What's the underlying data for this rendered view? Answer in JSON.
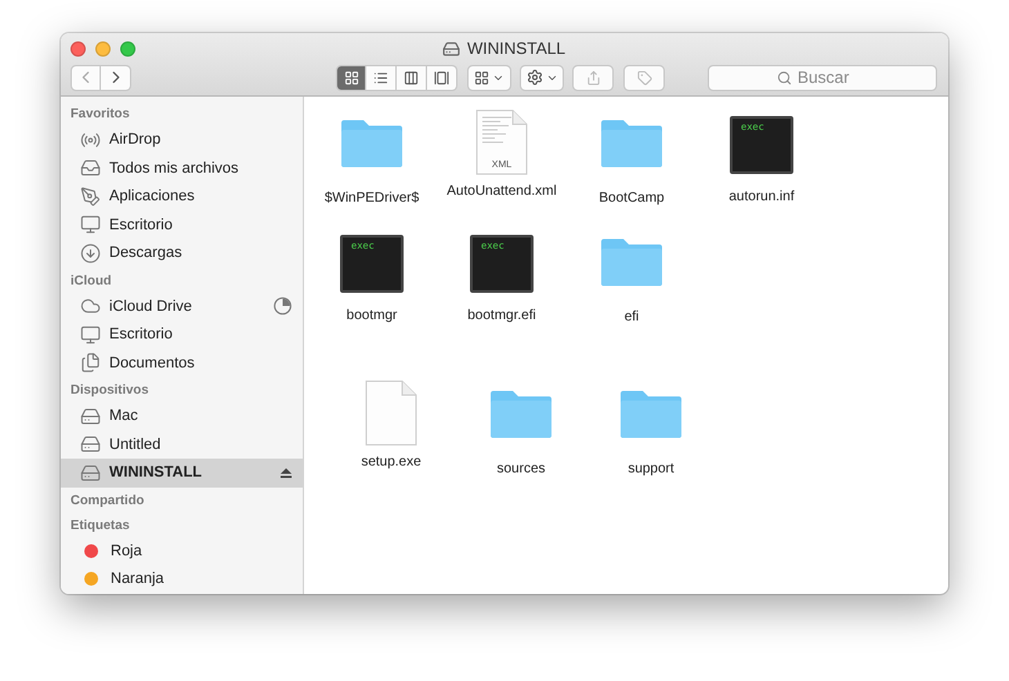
{
  "window": {
    "title": "WININSTALL"
  },
  "toolbar": {
    "view_modes": [
      {
        "selected": true
      },
      {
        "selected": false
      },
      {
        "selected": false
      },
      {
        "selected": false
      }
    ],
    "search": {
      "placeholder": "Buscar"
    }
  },
  "sidebar": {
    "sections": [
      {
        "title": "Favoritos",
        "items": [
          {
            "label": "AirDrop",
            "selected": false
          },
          {
            "label": "Todos mis archivos",
            "selected": false
          },
          {
            "label": "Aplicaciones",
            "selected": false
          },
          {
            "label": "Escritorio",
            "selected": false
          },
          {
            "label": "Descargas",
            "selected": false
          }
        ]
      },
      {
        "title": "iCloud",
        "items": [
          {
            "label": "iCloud Drive",
            "selected": false
          },
          {
            "label": "Escritorio",
            "selected": false
          },
          {
            "label": "Documentos",
            "selected": false
          }
        ]
      },
      {
        "title": "Dispositivos",
        "items": [
          {
            "label": "Mac",
            "selected": false,
            "ejectable": false
          },
          {
            "label": "Untitled",
            "selected": false,
            "ejectable": false
          },
          {
            "label": "WININSTALL",
            "selected": true,
            "ejectable": true
          }
        ]
      },
      {
        "title": "Compartido"
      },
      {
        "title": "Etiquetas",
        "items": [
          {
            "label": "Roja",
            "selected": false,
            "color": "#f0484a"
          },
          {
            "label": "Naranja",
            "selected": false,
            "color": "#f5a623"
          }
        ]
      }
    ]
  },
  "file_rows": [
    [
      {
        "name": "$WinPEDriver$",
        "kind": "folder"
      },
      {
        "name": "AutoUnattend.xml",
        "kind": "document",
        "badge": "XML"
      },
      {
        "name": "BootCamp",
        "kind": "folder"
      },
      {
        "name": "autorun.inf",
        "kind": "exec",
        "badge": "exec"
      }
    ],
    [
      {
        "name": "bootmgr",
        "kind": "exec",
        "badge": "exec"
      },
      {
        "name": "bootmgr.efi",
        "kind": "exec",
        "badge": "exec"
      },
      {
        "name": "efi",
        "kind": "folder"
      }
    ],
    [
      {
        "name": "setup.exe",
        "kind": "document"
      },
      {
        "name": "sources",
        "kind": "folder"
      },
      {
        "name": "support",
        "kind": "folder"
      }
    ]
  ]
}
